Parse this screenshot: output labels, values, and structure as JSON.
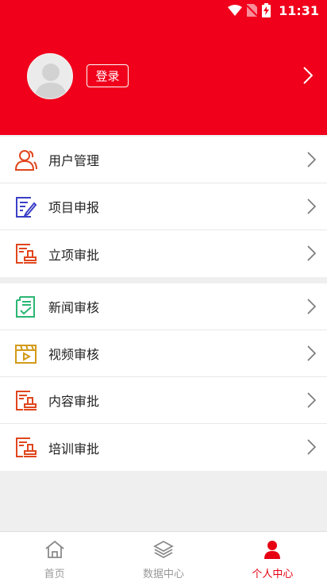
{
  "status_bar": {
    "time": "11:31"
  },
  "header": {
    "login_label": "登录"
  },
  "menu": {
    "group1": [
      {
        "label": "用户管理",
        "icon": "users-icon"
      },
      {
        "label": "项目申报",
        "icon": "edit-document-icon"
      },
      {
        "label": "立项审批",
        "icon": "stamp-icon"
      }
    ],
    "group2": [
      {
        "label": "新闻审核",
        "icon": "news-check-icon"
      },
      {
        "label": "视频审核",
        "icon": "video-icon"
      },
      {
        "label": "内容审批",
        "icon": "stamp-icon"
      },
      {
        "label": "培训审批",
        "icon": "stamp-icon"
      }
    ]
  },
  "tabbar": {
    "tabs": [
      {
        "label": "首页",
        "icon": "home-icon",
        "active": false
      },
      {
        "label": "数据中心",
        "icon": "layers-icon",
        "active": false
      },
      {
        "label": "个人中心",
        "icon": "person-icon",
        "active": true
      }
    ]
  },
  "colors": {
    "brand_red": "#f0001b",
    "active_tab": "#e60012",
    "inactive_tab": "#999999"
  }
}
